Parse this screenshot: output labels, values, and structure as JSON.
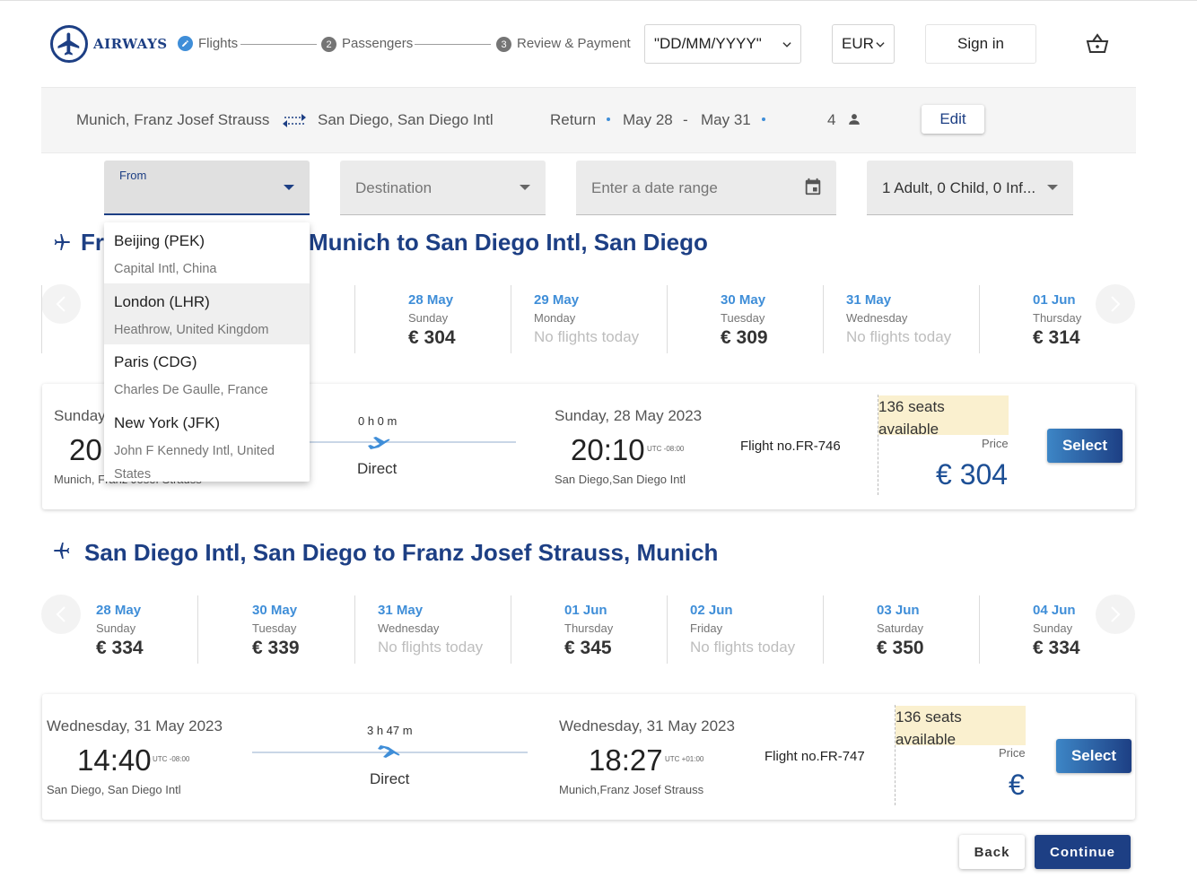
{
  "brand": {
    "name": "AIRWAYS"
  },
  "steps": [
    {
      "num": "",
      "label": "Flights"
    },
    {
      "num": "2",
      "label": "Passengers"
    },
    {
      "num": "3",
      "label": "Review & Payment"
    }
  ],
  "header": {
    "date_select": "\"DD/MM/YYYY\"",
    "currency_select": "EUR",
    "signin_label": "Sign in",
    "cart_icon": "basket-icon"
  },
  "summary": {
    "origin": "Munich, Franz Josef Strauss",
    "destination": "San Diego, San Diego Intl",
    "trip_type": "Return",
    "depart": "May 28",
    "separator": "-",
    "return": "May 31",
    "passengers": "4",
    "edit_label": "Edit"
  },
  "search": {
    "from_label": "From",
    "destination_placeholder": "Destination",
    "date_placeholder": "Enter a date range",
    "travellers": "1 Adult, 0 Child, 0 Inf..."
  },
  "dropdown": [
    {
      "title": "Beijing (PEK)",
      "sub": "Capital Intl, China"
    },
    {
      "title": "London (LHR)",
      "sub": "Heathrow, United Kingdom"
    },
    {
      "title": "Paris (CDG)",
      "sub": "Charles De Gaulle, France"
    },
    {
      "title": "New York (JFK)",
      "sub": "John F Kennedy Intl, United States"
    }
  ],
  "outbound": {
    "title_visible": "Munich to San Diego Intl, San Diego",
    "title_prefix": "Fr",
    "days": [
      {
        "date": "28 May",
        "weekday": "Sunday",
        "price": "€ 304",
        "available": true
      },
      {
        "date": "29 May",
        "weekday": "Monday",
        "price": "No flights today",
        "available": false
      },
      {
        "date": "30 May",
        "weekday": "Tuesday",
        "price": "€ 309",
        "available": true
      },
      {
        "date": "31 May",
        "weekday": "Wednesday",
        "price": "No flights today",
        "available": false
      },
      {
        "date": "01 Jun",
        "weekday": "Thursday",
        "price": "€ 314",
        "available": true
      }
    ],
    "card": {
      "dep_date": "Sunday",
      "dep_time": "20:",
      "dep_loc": "Munich, Franz Josef Strauss",
      "duration": "0 h 0 m",
      "stops": "Direct",
      "arr_date": "Sunday, 28 May 2023",
      "arr_time": "20:10",
      "arr_utc": "UTC -08:00",
      "arr_loc": "San Diego,San Diego Intl",
      "flight_no": "Flight no.FR-746",
      "seats": "136 seats available",
      "price_label": "Price",
      "price": "€ 304",
      "select_label": "Select"
    }
  },
  "inbound": {
    "title": "San Diego Intl, San Diego to Franz Josef Strauss, Munich",
    "days": [
      {
        "date": "28 May",
        "weekday": "Sunday",
        "price": "€ 334",
        "available": true
      },
      {
        "date": "30 May",
        "weekday": "Tuesday",
        "price": "€ 339",
        "available": true
      },
      {
        "date": "31 May",
        "weekday": "Wednesday",
        "price": "No flights today",
        "available": false
      },
      {
        "date": "01 Jun",
        "weekday": "Thursday",
        "price": "€ 345",
        "available": true
      },
      {
        "date": "02 Jun",
        "weekday": "Friday",
        "price": "No flights today",
        "available": false
      },
      {
        "date": "03 Jun",
        "weekday": "Saturday",
        "price": "€ 350",
        "available": true
      },
      {
        "date": "04 Jun",
        "weekday": "Sunday",
        "price": "€ 334",
        "available": true
      }
    ],
    "card": {
      "dep_date": "Wednesday, 31 May 2023",
      "dep_time": "14:40",
      "dep_utc": "UTC -08:00",
      "dep_loc": "San Diego, San Diego Intl",
      "duration": "3 h 47 m",
      "stops": "Direct",
      "arr_date": "Wednesday, 31 May 2023",
      "arr_time": "18:27",
      "arr_utc": "UTC +01:00",
      "arr_loc": "Munich,Franz Josef Strauss",
      "flight_no": "Flight no.FR-747",
      "seats": "136 seats available",
      "price_label": "Price",
      "price": "€",
      "select_label": "Select"
    }
  },
  "footer": {
    "back_label": "Back",
    "continue_label": "Continue"
  },
  "colors": {
    "brand": "#1d3f84",
    "accent": "#3f8ed8",
    "seats_bg": "#faf0cf"
  }
}
